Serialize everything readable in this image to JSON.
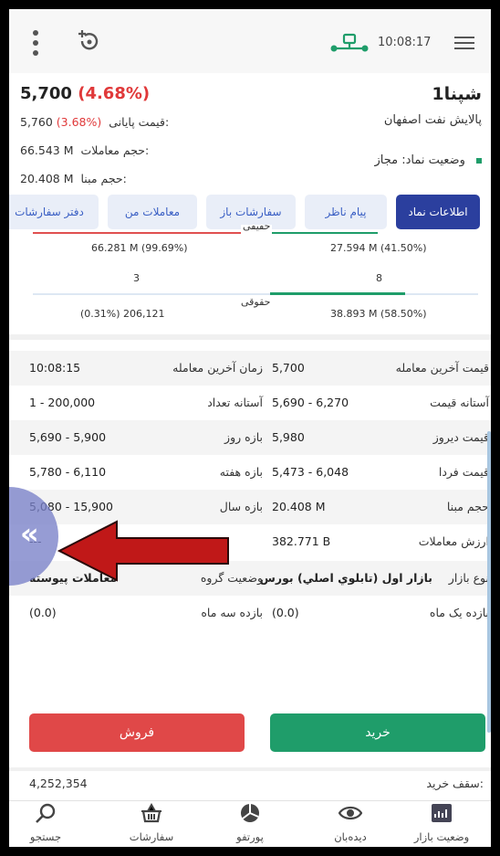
{
  "topbar": {
    "time": "10:08:17",
    "icons": [
      "more-vertical-icon",
      "add-watch-icon",
      "network-icon",
      "menu-icon"
    ]
  },
  "symbol": {
    "name": "شپنا1",
    "company": "پالایش نفت اصفهان",
    "price": "5,700",
    "change_pct": "(4.68%)",
    "final_price_label": "قیمت پایانی:",
    "final_price_value": "5,760",
    "final_price_pct": "(3.68%)",
    "volume_label": "حجم معاملات:",
    "volume_value": "66.543 M",
    "base_volume_label": "حجم مبنا:",
    "base_volume_value": "20.408 M",
    "status_label": "وضعیت نماد:",
    "status_value": "مجاز"
  },
  "tabs": [
    {
      "label": "اطلاعات نماد",
      "active": true
    },
    {
      "label": "پیام ناظر",
      "active": false
    },
    {
      "label": "سفارشات باز",
      "active": false
    },
    {
      "label": "معاملات من",
      "active": false
    },
    {
      "label": "دفتر سفارشات",
      "active": false
    }
  ],
  "individual_legal": {
    "individual_label": "حقیقی",
    "individual_sell": "66.281 M (99.69%)",
    "individual_buy": "27.594 M (41.50%)",
    "individual_sell_count": "3",
    "individual_buy_count": "8",
    "legal_label": "حقوقی",
    "legal_sell": "(0.31%) 206,121",
    "legal_buy": "38.893 M (58.50%)",
    "legal_buy_ratio": 0.585
  },
  "details": {
    "last_trade_price_label": "قیمت آخرین معامله",
    "last_trade_price": "5,700",
    "last_trade_time_label": "زمان آخرین معامله",
    "last_trade_time": "10:08:15",
    "price_threshold_label": "آستانه قیمت",
    "price_threshold": "5,690 - 6,270",
    "count_threshold_label": "آستانه تعداد",
    "count_threshold": "1 - 200,000",
    "yesterday_price_label": "قیمت دیروز",
    "yesterday_price": "5,980",
    "day_range_label": "بازه روز",
    "day_range": "5,690 - 5,900",
    "tomorrow_price_label": "قیمت فردا",
    "tomorrow_price": "5,473 - 6,048",
    "week_range_label": "بازه هفته",
    "week_range": "5,780 - 6,110",
    "base_volume_label": "حجم مبنا",
    "base_volume": "20.408 M",
    "year_range_label": "بازه سال",
    "year_range": "5,080 - 15,900",
    "trade_value_label": "ارزش معاملات",
    "trade_value": "382.771 B",
    "unknown_value": "---",
    "market_type_label": "نوع بازار",
    "market_type": "بازار اول (تابلوي اصلي) بورس",
    "group_status_label": "وضعیت گروه",
    "group_status": "معاملات پیوسته",
    "one_month_label": "بازده یک ماه",
    "one_month": "(0.0)",
    "three_month_label": "بازده سه ماه",
    "three_month": "(0.0)"
  },
  "actions": {
    "buy_label": "خرید",
    "sell_label": "فروش",
    "buy_color": "#1f9d6a",
    "sell_color": "#e04848"
  },
  "buy_ceiling": {
    "label": "سقف خرید:",
    "value": "4,252,354"
  },
  "bottom_nav": [
    {
      "label": "وضعیت بازار",
      "icon": "market-status-icon"
    },
    {
      "label": "دیده‌بان",
      "icon": "eye-icon"
    },
    {
      "label": "پورتفو",
      "icon": "portfolio-icon"
    },
    {
      "label": "سفارشات",
      "icon": "basket-icon"
    },
    {
      "label": "جستجو",
      "icon": "search-icon"
    }
  ],
  "side_handle": {
    "glyph": "«"
  }
}
